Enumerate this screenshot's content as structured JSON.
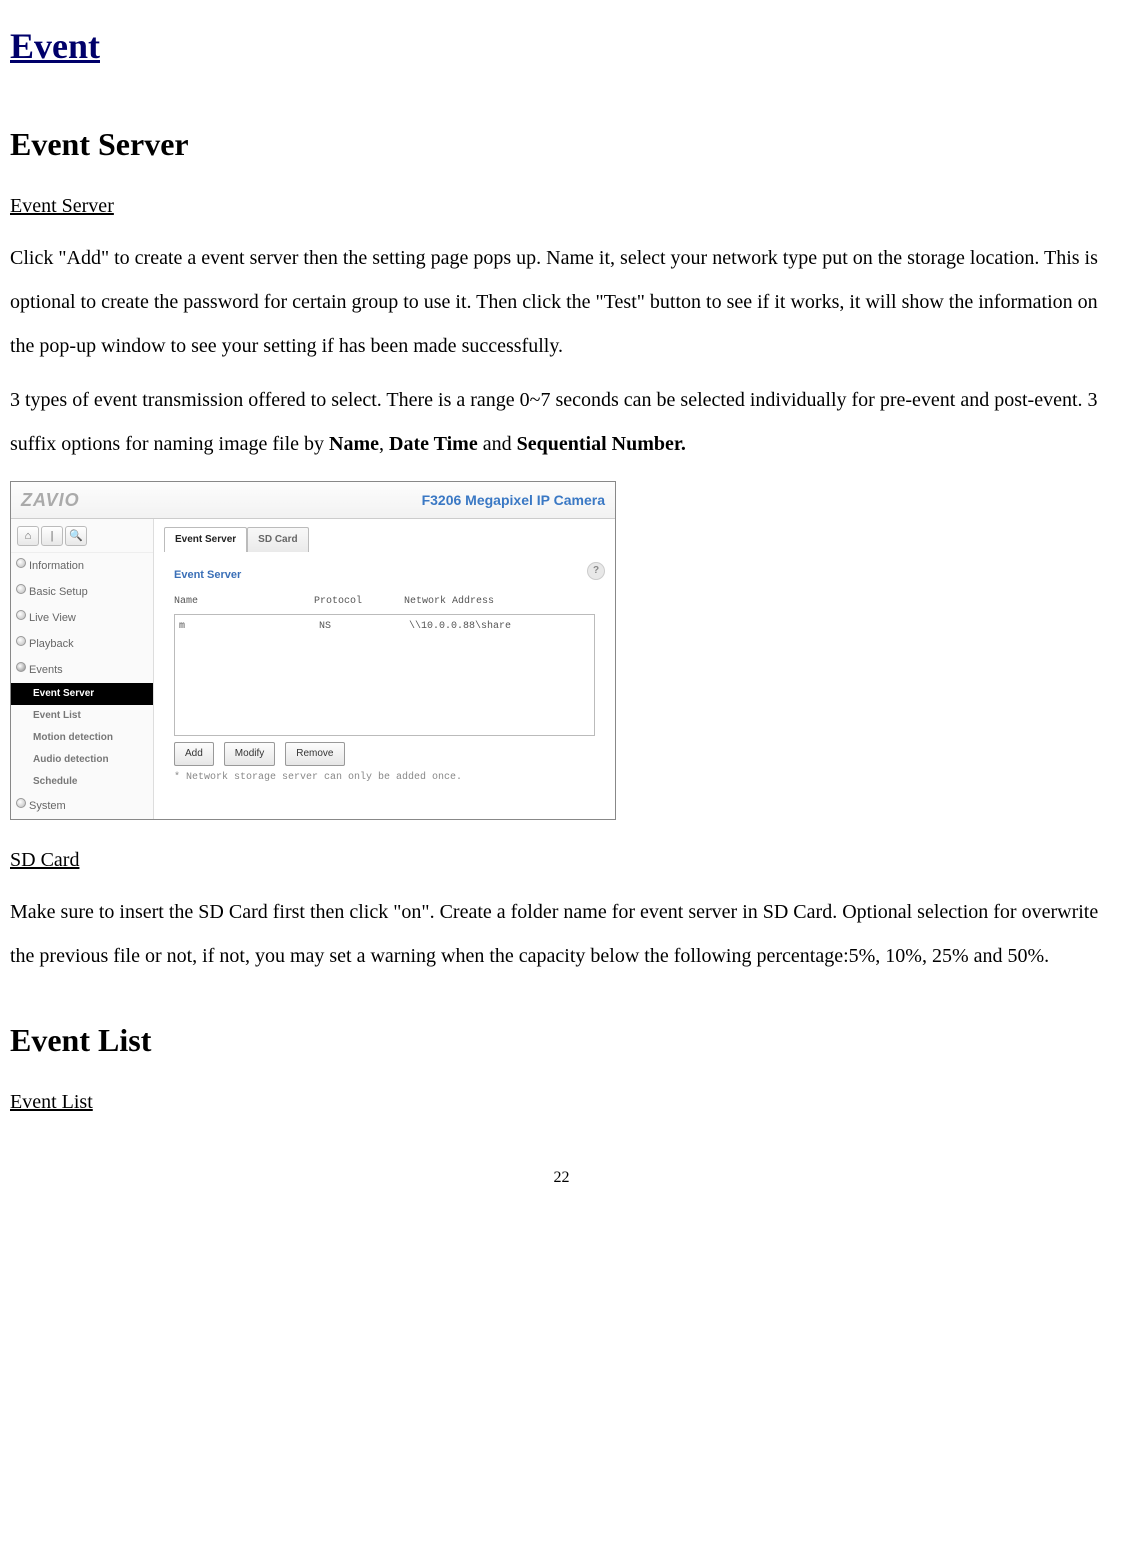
{
  "page": {
    "title_link": "Event",
    "page_number": "22"
  },
  "sec1": {
    "heading": "Event Server",
    "sub": "Event Server",
    "para1_pre": "Click \"Add\" to create a event server then the setting page pops up. Name it, select your network type put on the storage location. This is optional to create the password for certain group to use it. Then click the \"Test\" button to see if it works, it will show the information on the pop-up window to see your setting if has been made successfully.",
    "para2_pre": "3 types of event transmission offered to select. There is a range 0~7 seconds can be selected individually for pre-event and post-event. 3 suffix options for naming image file by ",
    "bold_name": "Name",
    "sep1": ", ",
    "bold_dt": "Date Time",
    "sep2": " and ",
    "bold_seq": "Sequential Number.",
    "sub2": "SD Card",
    "para3": "Make sure to insert the SD Card first then click \"on\". Create a folder name for event server in SD Card. Optional selection for overwrite the previous file or not, if not, you may set a warning when the capacity below the following percentage:5%, 10%, 25% and 50%."
  },
  "sec2": {
    "heading": "Event List",
    "sub": "Event List"
  },
  "ui": {
    "logo": "ZAVIO",
    "cam_title": "F3206 Megapixel IP Camera",
    "toolbar": {
      "home": "⌂",
      "sep": "|",
      "search": "🔍"
    },
    "sidebar": {
      "information": "Information",
      "basic": "Basic Setup",
      "live": "Live View",
      "playback": "Playback",
      "events": "Events",
      "events_children": {
        "event_server": "Event Server",
        "event_list": "Event List",
        "motion": "Motion detection",
        "audio": "Audio detection",
        "schedule": "Schedule"
      },
      "system": "System"
    },
    "tabs": {
      "t1": "Event Server",
      "t2": "SD Card"
    },
    "pane_title": "Event Server",
    "help": "?",
    "cols": {
      "c1": "Name",
      "c2": "Protocol",
      "c3": "Network Address"
    },
    "row": {
      "c1": "m",
      "c2": "NS",
      "c3": "\\\\10.0.0.88\\share"
    },
    "buttons": {
      "add": "Add",
      "modify": "Modify",
      "remove": "Remove"
    },
    "note": "* Network storage server can only be added once."
  }
}
